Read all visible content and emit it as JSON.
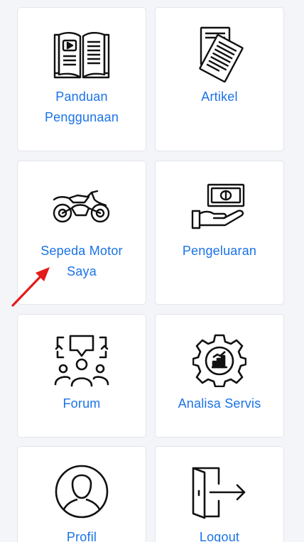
{
  "menu": {
    "panduan": {
      "label_line1": "Panduan",
      "label_line2": "Penggunaan",
      "icon": "book-icon"
    },
    "artikel": {
      "label": "Artikel",
      "icon": "article-icon"
    },
    "motor": {
      "label_line1": "Sepeda Motor",
      "label_line2": "Saya",
      "icon": "motorcycle-icon"
    },
    "pengeluaran": {
      "label": "Pengeluaran",
      "icon": "money-hand-icon"
    },
    "forum": {
      "label": "Forum",
      "icon": "forum-icon"
    },
    "analisa": {
      "label": "Analisa Servis",
      "icon": "gear-chart-icon"
    },
    "profil": {
      "label": "Profil",
      "icon": "profile-icon"
    },
    "logout": {
      "label": "Logout",
      "icon": "logout-icon"
    }
  },
  "colors": {
    "label": "#1a73e8",
    "pointer_arrow": "#e31b1b",
    "icon": "#111111"
  }
}
